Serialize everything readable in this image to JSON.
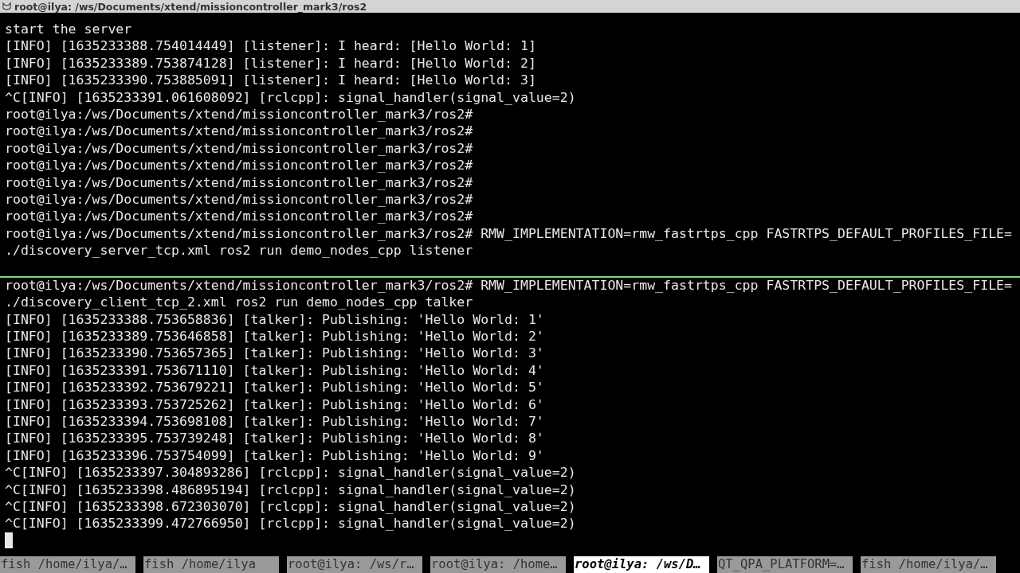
{
  "window": {
    "title": "root@ilya: /ws/Documents/xtend/missioncontroller_mark3/ros2"
  },
  "panes": [
    {
      "lines": [
        "start the server",
        "[INFO] [1635233388.754014449] [listener]: I heard: [Hello World: 1]",
        "[INFO] [1635233389.753874128] [listener]: I heard: [Hello World: 2]",
        "[INFO] [1635233390.753885091] [listener]: I heard: [Hello World: 3]",
        "^C[INFO] [1635233391.061608092] [rclcpp]: signal_handler(signal_value=2)",
        "root@ilya:/ws/Documents/xtend/missioncontroller_mark3/ros2#",
        "root@ilya:/ws/Documents/xtend/missioncontroller_mark3/ros2#",
        "root@ilya:/ws/Documents/xtend/missioncontroller_mark3/ros2#",
        "root@ilya:/ws/Documents/xtend/missioncontroller_mark3/ros2#",
        "root@ilya:/ws/Documents/xtend/missioncontroller_mark3/ros2#",
        "root@ilya:/ws/Documents/xtend/missioncontroller_mark3/ros2#",
        "root@ilya:/ws/Documents/xtend/missioncontroller_mark3/ros2#",
        "root@ilya:/ws/Documents/xtend/missioncontroller_mark3/ros2# RMW_IMPLEMENTATION=rmw_fastrtps_cpp FASTRTPS_DEFAULT_PROFILES_FILE=",
        "./discovery_server_tcp.xml ros2 run demo_nodes_cpp listener"
      ]
    },
    {
      "cursor": true,
      "lines": [
        "root@ilya:/ws/Documents/xtend/missioncontroller_mark3/ros2# RMW_IMPLEMENTATION=rmw_fastrtps_cpp FASTRTPS_DEFAULT_PROFILES_FILE=",
        "./discovery_client_tcp_2.xml ros2 run demo_nodes_cpp talker",
        "[INFO] [1635233388.753658836] [talker]: Publishing: 'Hello World: 1'",
        "[INFO] [1635233389.753646858] [talker]: Publishing: 'Hello World: 2'",
        "[INFO] [1635233390.753657365] [talker]: Publishing: 'Hello World: 3'",
        "[INFO] [1635233391.753671110] [talker]: Publishing: 'Hello World: 4'",
        "[INFO] [1635233392.753679221] [talker]: Publishing: 'Hello World: 5'",
        "[INFO] [1635233393.753725262] [talker]: Publishing: 'Hello World: 6'",
        "[INFO] [1635233394.753698108] [talker]: Publishing: 'Hello World: 7'",
        "[INFO] [1635233395.753739248] [talker]: Publishing: 'Hello World: 8'",
        "[INFO] [1635233396.753754099] [talker]: Publishing: 'Hello World: 9'",
        "^C[INFO] [1635233397.304893286] [rclcpp]: signal_handler(signal_value=2)",
        "^C[INFO] [1635233398.486895194] [rclcpp]: signal_handler(signal_value=2)",
        "^C[INFO] [1635233398.672303070] [rclcpp]: signal_handler(signal_value=2)",
        "^C[INFO] [1635233399.472766950] [rclcpp]: signal_handler(signal_value=2)"
      ]
    }
  ],
  "tabs": [
    {
      "label": "fish /home/ilya/…",
      "selected": false
    },
    {
      "label": "fish /home/ilya",
      "selected": false
    },
    {
      "label": "root@ilya: /ws/r…",
      "selected": false
    },
    {
      "label": "root@ilya: /home…",
      "selected": false
    },
    {
      "label": "root@ilya: /ws/D…",
      "selected": true
    },
    {
      "label": "QT_QPA_PLATFORM=…",
      "selected": false
    },
    {
      "label": "fish /home/ilya/…",
      "selected": false
    }
  ]
}
